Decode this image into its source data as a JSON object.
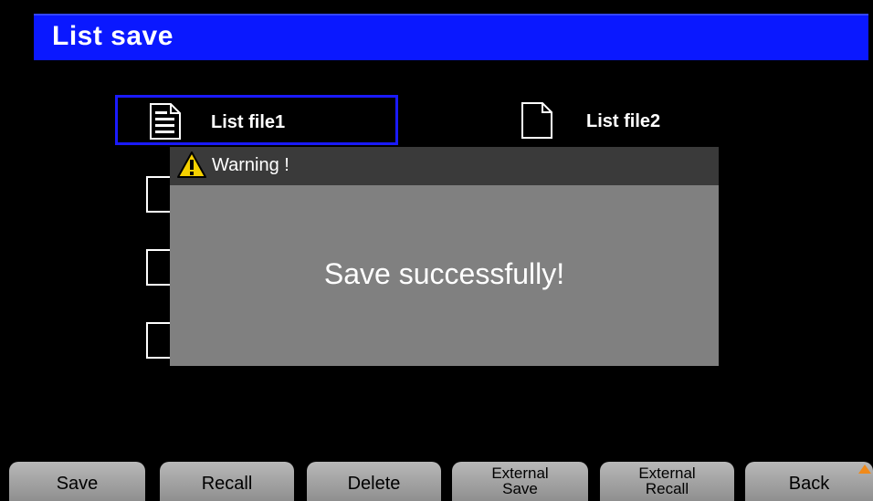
{
  "header": {
    "title": "List save"
  },
  "files": [
    {
      "label": "List file1",
      "state": "saved",
      "selected": true
    },
    {
      "label": "List file2",
      "state": "empty",
      "selected": false
    }
  ],
  "dialog": {
    "title": "Warning !",
    "message": "Save successfully!"
  },
  "softkeys": {
    "save": "Save",
    "recall": "Recall",
    "delete": "Delete",
    "external_save_line1": "External",
    "external_save_line2": "Save",
    "external_recall_line1": "External",
    "external_recall_line2": "Recall",
    "back": "Back"
  },
  "colors": {
    "title_bar": "#0a18ff",
    "selection_border": "#1a1aff",
    "dialog_body": "#808080",
    "dialog_header": "#3a3a3a",
    "warning_icon": "#f5d000",
    "back_arrow": "#f08a1a"
  }
}
